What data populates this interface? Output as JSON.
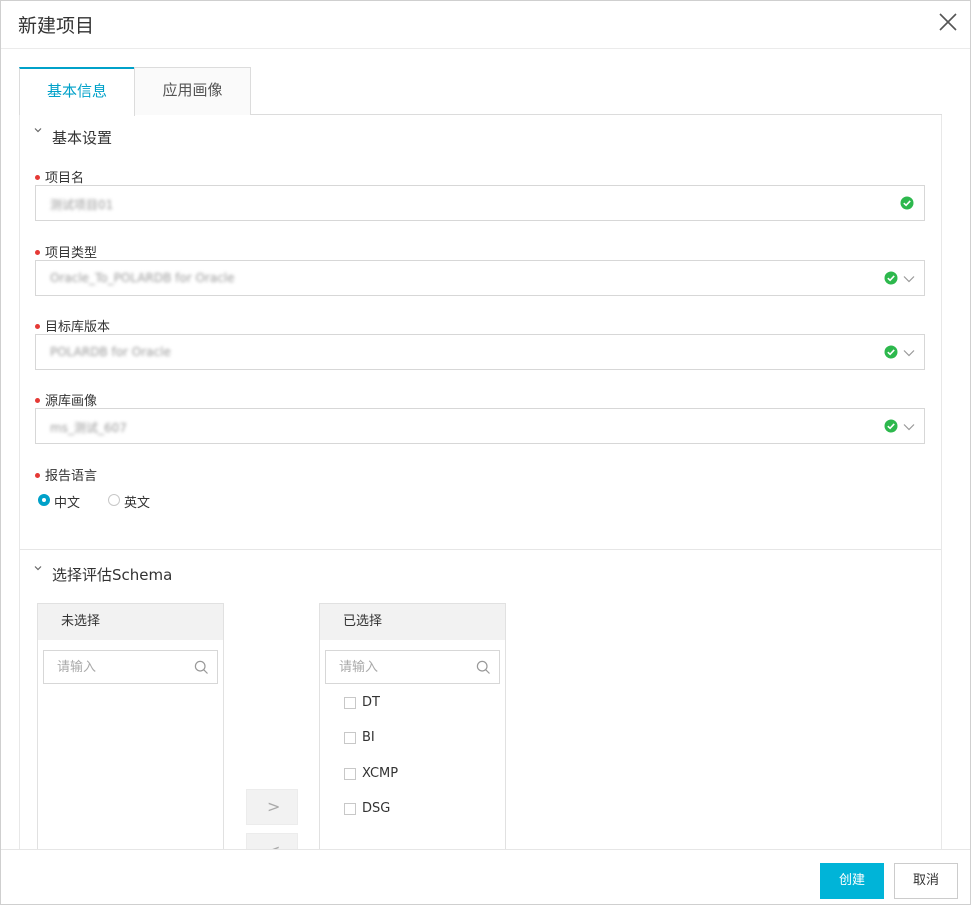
{
  "dialog": {
    "title": "新建项目"
  },
  "tabs": [
    {
      "label": "基本信息",
      "active": true
    },
    {
      "label": "应用画像",
      "active": false
    }
  ],
  "basic_section": {
    "title": "基本设置",
    "fields": [
      {
        "label": "项目名",
        "value": "测试项目01",
        "required": true,
        "status": "valid",
        "dropdown": false
      },
      {
        "label": "项目类型",
        "value": "Oracle_To_POLARDB for Oracle",
        "required": true,
        "status": "valid",
        "dropdown": true
      },
      {
        "label": "目标库版本",
        "value": "POLARDB for Oracle",
        "required": true,
        "status": "valid",
        "dropdown": true
      },
      {
        "label": "源库画像",
        "value": "ms_测试_607",
        "required": true,
        "status": "valid",
        "dropdown": true
      }
    ],
    "language": {
      "label": "报告语言",
      "options": [
        {
          "label": "中文",
          "checked": true
        },
        {
          "label": "英文",
          "checked": false
        }
      ]
    }
  },
  "schema_section": {
    "title": "选择评估Schema",
    "unselected": {
      "header": "未选择",
      "search_placeholder": "请输入",
      "items": []
    },
    "selected": {
      "header": "已选择",
      "search_placeholder": "请输入",
      "items": [
        "DT",
        "BI",
        "XCMP",
        "DSG"
      ]
    },
    "move_right_glyph": ">",
    "move_left_glyph": "<"
  },
  "footer": {
    "create_label": "创建",
    "cancel_label": "取消"
  },
  "colors": {
    "accent": "#00a1c9",
    "primary_button": "#00b4d8",
    "valid": "#2db84d",
    "required": "#e53935"
  }
}
